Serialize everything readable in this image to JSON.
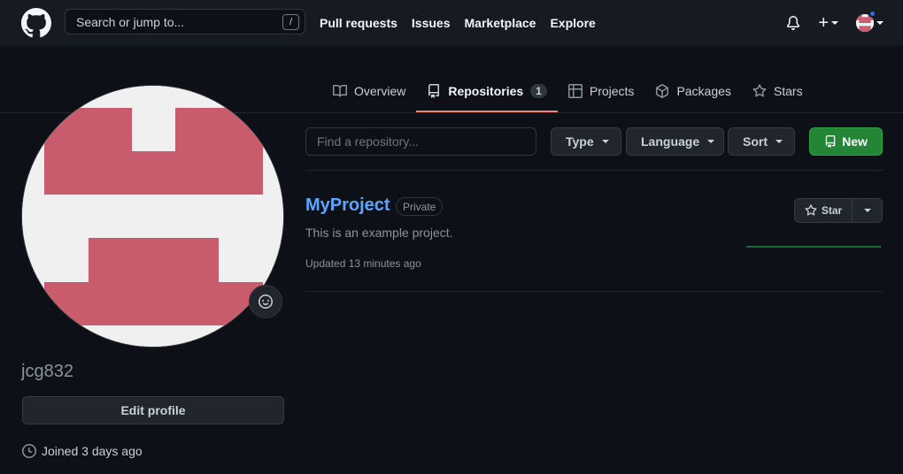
{
  "header": {
    "search_placeholder": "Search or jump to...",
    "search_shortcut": "/",
    "nav": [
      "Pull requests",
      "Issues",
      "Marketplace",
      "Explore"
    ],
    "plus": "+"
  },
  "tabs": [
    {
      "label": "Overview"
    },
    {
      "label": "Repositories",
      "count": "1",
      "active": true
    },
    {
      "label": "Projects"
    },
    {
      "label": "Packages"
    },
    {
      "label": "Stars"
    }
  ],
  "profile": {
    "username": "jcg832",
    "edit_label": "Edit profile",
    "joined": "Joined 3 days ago"
  },
  "filters": {
    "find_placeholder": "Find a repository...",
    "type": "Type",
    "language": "Language",
    "sort": "Sort",
    "new": "New"
  },
  "repo": {
    "name": "MyProject",
    "visibility": "Private",
    "description": "This is an example project.",
    "updated": "Updated 13 minutes ago",
    "star_label": "Star"
  },
  "colors": {
    "accent_link": "#58a6ff",
    "primary_button": "#238636",
    "active_tab_underline": "#f78166",
    "identicon": "#c85c6c"
  }
}
